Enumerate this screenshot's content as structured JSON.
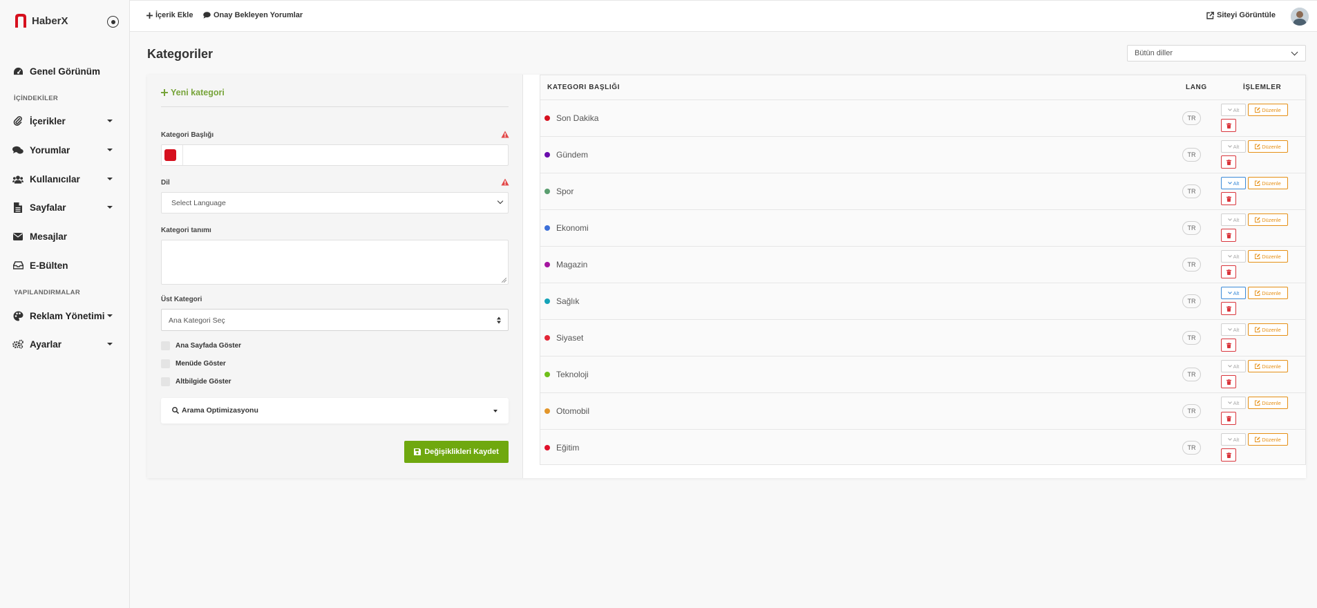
{
  "app": {
    "name": "HaberX"
  },
  "colors": {
    "brand": "#d6101e",
    "accent": "#6fa80f",
    "edit": "#e58e12",
    "delete": "#d9343b",
    "alt_active": "#3b8ad8"
  },
  "sidebar": {
    "overview": "Genel Görünüm",
    "section_contents": "İÇİNDEKİLER",
    "contents": "İçerikler",
    "comments": "Yorumlar",
    "users": "Kullanıcılar",
    "pages": "Sayfalar",
    "messages": "Mesajlar",
    "newsletter": "E-Bülten",
    "section_config": "YAPILANDIRMALAR",
    "ads": "Reklam Yönetimi",
    "settings": "Ayarlar"
  },
  "topbar": {
    "add_content": "İçerik Ekle",
    "pending_comments": "Onay Bekleyen Yorumlar",
    "view_site": "Siteyi Görüntüle"
  },
  "page": {
    "title": "Kategoriler",
    "language_filter": "Bütün diller"
  },
  "form": {
    "new_category": "Yeni kategori",
    "title_label": "Kategori Başlığı",
    "title_value": "",
    "color_value": "#d6101e",
    "lang_label": "Dil",
    "lang_placeholder": "Select Language",
    "desc_label": "Kategori tanımı",
    "desc_value": "",
    "parent_label": "Üst Kategori",
    "parent_placeholder": "Ana Kategori Seç",
    "show_home": "Ana Sayfada Göster",
    "show_menu": "Menüde Göster",
    "show_footer": "Altbilgide Göster",
    "seo_label": "Arama Optimizasyonu",
    "save_label": "Değişiklikleri Kaydet"
  },
  "table": {
    "col_title": "KATEGORI BAŞLIĞI",
    "col_lang": "LANG",
    "col_actions": "İŞLEMLER",
    "alt_label": "Alt",
    "edit_label": "Düzenle",
    "rows": [
      {
        "title": "Son Dakika",
        "lang": "TR",
        "color": "#d6101e",
        "alt_active": false
      },
      {
        "title": "Gündem",
        "lang": "TR",
        "color": "#6a0dad",
        "alt_active": false
      },
      {
        "title": "Spor",
        "lang": "TR",
        "color": "#5a9e6f",
        "alt_active": true
      },
      {
        "title": "Ekonomi",
        "lang": "TR",
        "color": "#3c6fd8",
        "alt_active": false
      },
      {
        "title": "Magazin",
        "lang": "TR",
        "color": "#a516a0",
        "alt_active": false
      },
      {
        "title": "Sağlık",
        "lang": "TR",
        "color": "#14a3b8",
        "alt_active": true
      },
      {
        "title": "Siyaset",
        "lang": "TR",
        "color": "#e32636",
        "alt_active": false
      },
      {
        "title": "Teknoloji",
        "lang": "TR",
        "color": "#6fbf1a",
        "alt_active": false
      },
      {
        "title": "Otomobil",
        "lang": "TR",
        "color": "#e3962a",
        "alt_active": false
      },
      {
        "title": "Eğitim",
        "lang": "TR",
        "color": "#e0102a",
        "alt_active": false
      }
    ]
  }
}
